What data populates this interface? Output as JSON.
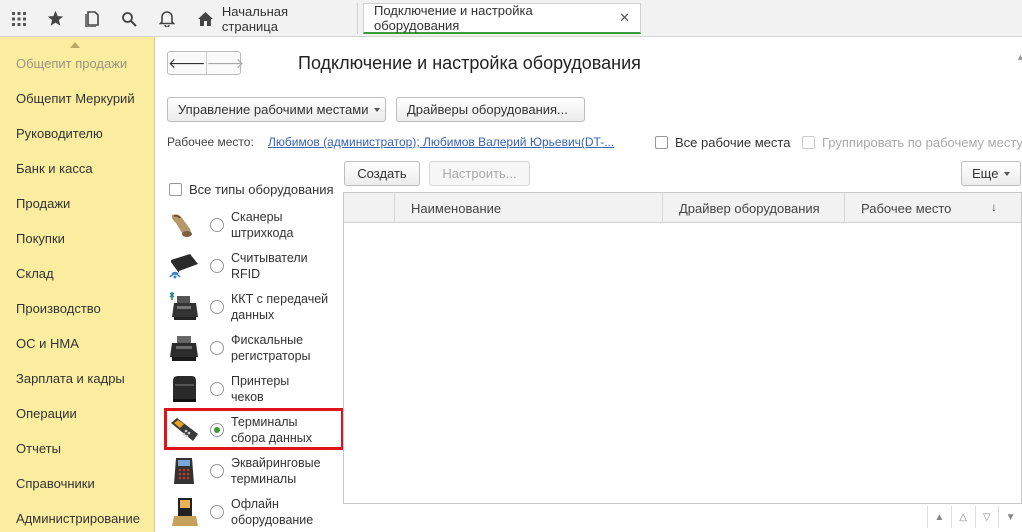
{
  "topbar": {
    "icons": [
      "apps-grid-icon",
      "star-icon",
      "history-icon",
      "search-icon",
      "bell-icon"
    ],
    "home_tab": "Начальная страница",
    "active_tab": "Подключение и настройка оборудования"
  },
  "sidebar": {
    "items": [
      "Общепит продажи",
      "Общепит Меркурий",
      "Руководителю",
      "Банк и касса",
      "Продажи",
      "Покупки",
      "Склад",
      "Производство",
      "ОС и НМА",
      "Зарплата и кадры",
      "Операции",
      "Отчеты",
      "Справочники",
      "Администрирование"
    ],
    "bg_color": "#fbeda0"
  },
  "main": {
    "title": "Подключение и настройка оборудования",
    "manage_workplaces_label": "Управление рабочими местами",
    "drivers_label": "Драйверы оборудования...",
    "workplace_label": "Рабочее место:",
    "workplace_value": "Любимов (администратор); Любимов Валерий Юрьевич(DT-...",
    "all_workplaces_label": "Все рабочие места",
    "group_by_workplace_label": "Группировать по рабочему месту",
    "all_types_label": "Все типы оборудования",
    "create_label": "Создать",
    "configure_label": "Настроить...",
    "more_label": "Еще",
    "device_types": [
      {
        "line1": "Сканеры",
        "line2": "штрихкода",
        "icon": "barcode-scanner-icon",
        "selected": false
      },
      {
        "line1": "Считыватели",
        "line2": "RFID",
        "icon": "rfid-reader-icon",
        "selected": false
      },
      {
        "line1": "ККТ с передачей",
        "line2": "данных",
        "icon": "cash-register-icon",
        "selected": false
      },
      {
        "line1": "Фискальные",
        "line2": "регистраторы",
        "icon": "fiscal-printer-icon",
        "selected": false
      },
      {
        "line1": "Принтеры",
        "line2": "чеков",
        "icon": "receipt-printer-icon",
        "selected": false
      },
      {
        "line1": "Терминалы",
        "line2": "сбора данных",
        "icon": "data-terminal-icon",
        "selected": true
      },
      {
        "line1": "Эквайринговые",
        "line2": "терминалы",
        "icon": "pos-terminal-icon",
        "selected": false
      },
      {
        "line1": "Офлайн",
        "line2": "оборудование",
        "icon": "offline-device-icon",
        "selected": false
      }
    ],
    "table": {
      "columns": [
        "Наименование",
        "Драйвер оборудования",
        "Рабочее место"
      ],
      "rows": []
    }
  },
  "colors": {
    "accent_green": "#3b9a3b",
    "link_blue": "#3a63b6",
    "highlight_red": "#e0121a"
  }
}
